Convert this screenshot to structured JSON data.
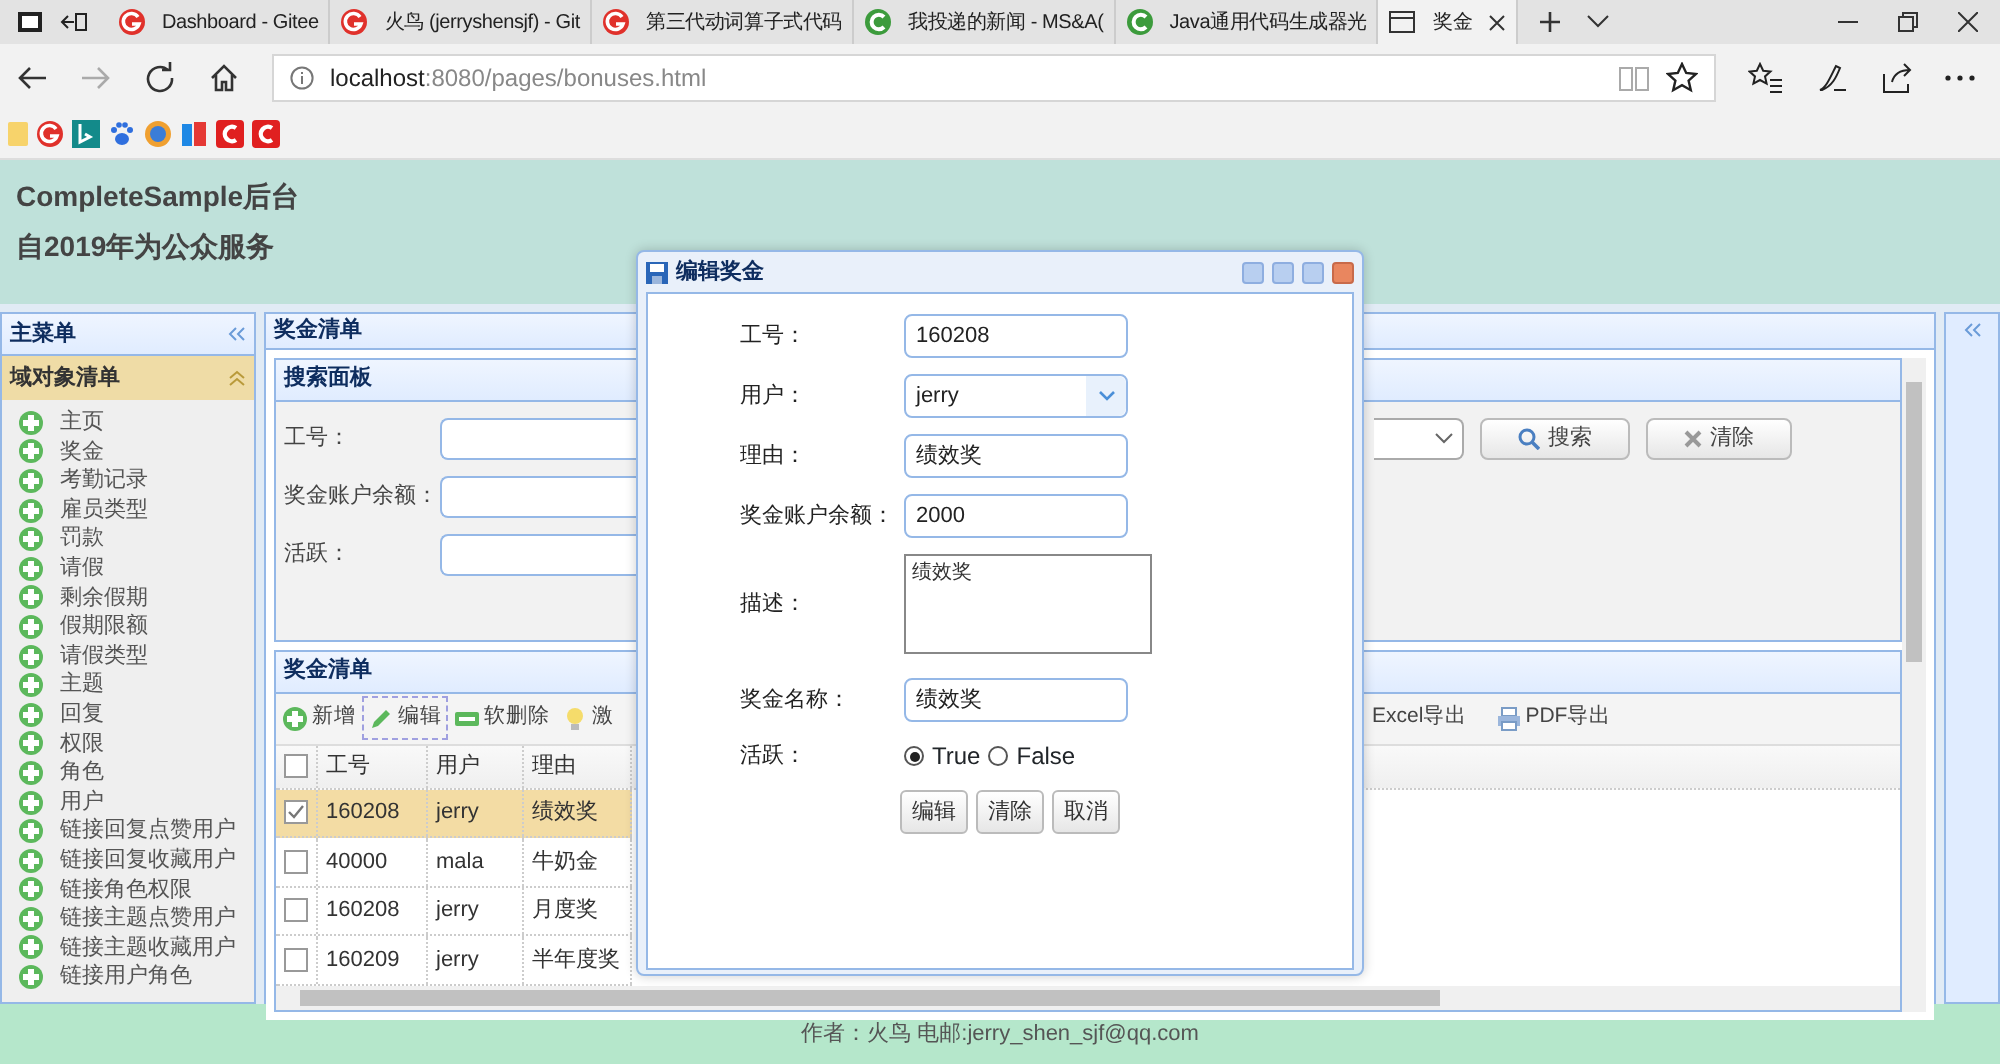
{
  "browser": {
    "tabs": [
      {
        "title": "Dashboard - Gitee",
        "kind": "gitee",
        "selected": false
      },
      {
        "title": "火鸟 (jerryshensjf) - Git",
        "kind": "gitee",
        "selected": false
      },
      {
        "title": "第三代动词算子式代码",
        "kind": "gitee",
        "selected": false
      },
      {
        "title": "我投递的新闻 - MS&A(",
        "kind": "c",
        "selected": false
      },
      {
        "title": "Java通用代码生成器光",
        "kind": "c",
        "selected": false
      },
      {
        "title": "奖金",
        "kind": "page",
        "selected": true
      }
    ],
    "url": {
      "host": "localhost",
      "rest": ":8080/pages/bonuses.html"
    }
  },
  "header": {
    "title": "CompleteSample后台",
    "subtitle": "自2019年为公众服务"
  },
  "sidebar": {
    "title": "主菜单",
    "section": {
      "title": "域对象清单",
      "expanded": true
    },
    "items": [
      "主页",
      "奖金",
      "考勤记录",
      "雇员类型",
      "罚款",
      "请假",
      "剩余假期",
      "假期限额",
      "请假类型",
      "主题",
      "回复",
      "权限",
      "角色",
      "用户",
      "链接回复点赞用户",
      "链接回复收藏用户",
      "链接角色权限",
      "链接主题点赞用户",
      "链接主题收藏用户",
      "链接用户角色"
    ]
  },
  "main": {
    "title": "奖金清单",
    "search": {
      "title": "搜索面板",
      "fields": [
        "工号：",
        "奖金账户余额：",
        "活跃："
      ],
      "buttons": [
        {
          "label": "搜索",
          "kind": "search"
        },
        {
          "label": "清除",
          "kind": "clear"
        }
      ]
    },
    "grid": {
      "title": "奖金清单",
      "toolbar_left": [
        {
          "label": "新增",
          "kind": "add",
          "selected": false
        },
        {
          "label": "编辑",
          "kind": "edit",
          "selected": true
        },
        {
          "label": "软删除",
          "kind": "remove",
          "selected": false
        },
        {
          "label": "激",
          "kind": "bulb",
          "selected": false
        }
      ],
      "toolbar_right": [
        {
          "label": "Excel导出",
          "kind": "none",
          "selected": false
        },
        {
          "label": "PDF导出",
          "kind": "print",
          "selected": false
        }
      ],
      "all_checked": false,
      "columns": [
        "工号",
        "用户",
        "理由"
      ],
      "rows": [
        {
          "cells": [
            "160208",
            "jerry",
            "绩效奖"
          ],
          "selected": true
        },
        {
          "cells": [
            "40000",
            "mala",
            "牛奶金"
          ],
          "selected": false
        },
        {
          "cells": [
            "160208",
            "jerry",
            "月度奖"
          ],
          "selected": false
        },
        {
          "cells": [
            "160209",
            "jerry",
            "半年度奖"
          ],
          "selected": false
        }
      ]
    }
  },
  "dialog": {
    "title": "编辑奖金",
    "fields": [
      {
        "kind": "text",
        "label": "工号：",
        "value": "160208"
      },
      {
        "kind": "select",
        "label": "用户：",
        "value": "jerry"
      },
      {
        "kind": "text",
        "label": "理由：",
        "value": "绩效奖"
      },
      {
        "kind": "text",
        "label": "奖金账户余额：",
        "value": "2000"
      },
      {
        "kind": "textarea",
        "label": "描述：",
        "value": "绩效奖"
      },
      {
        "kind": "text",
        "label": "奖金名称：",
        "value": "绩效奖"
      },
      {
        "kind": "radio",
        "label": "活跃：",
        "options": [
          {
            "label": "True",
            "selected": true
          },
          {
            "label": "False",
            "selected": false
          }
        ]
      }
    ],
    "buttons": [
      "编辑",
      "清除",
      "取消"
    ]
  },
  "footer": "作者：火鸟 电邮:jerry_shen_sjf@qq.com"
}
